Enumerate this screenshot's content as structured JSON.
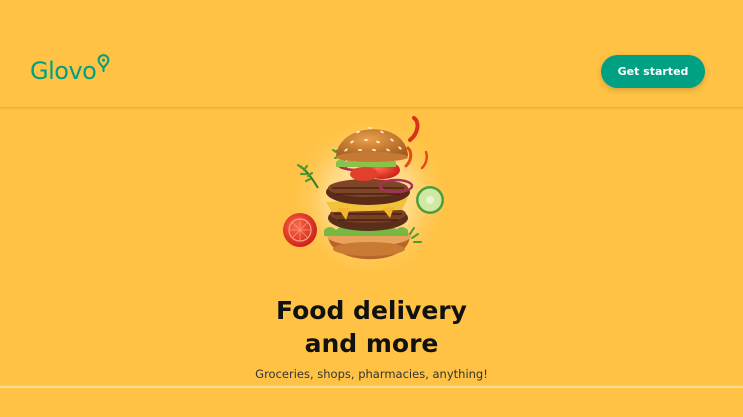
{
  "header": {
    "logo_text": "Glovo",
    "cta_label": "Get started"
  },
  "hero": {
    "title_line1": "Food delivery",
    "title_line2": "and more",
    "subtitle": "Groceries, shops, pharmacies, anything!"
  },
  "colors": {
    "background": "#FFC244",
    "brand_green": "#00A082",
    "text_dark": "#111111"
  },
  "icons": {
    "logo_pin": "location-pin-icon",
    "hero_image": "burger-illustration"
  }
}
